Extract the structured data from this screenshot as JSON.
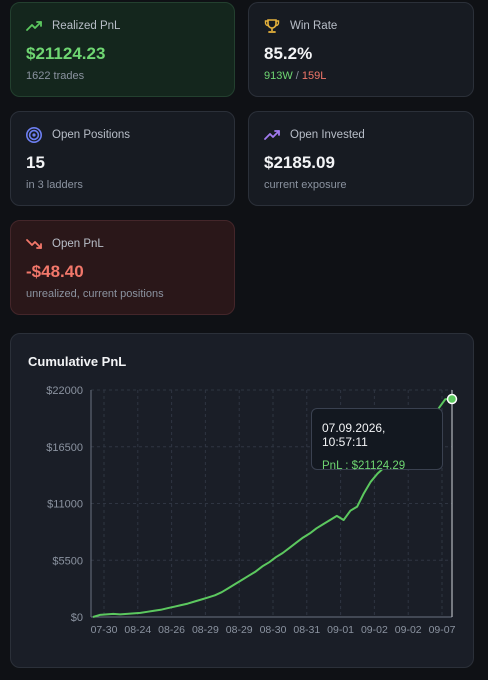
{
  "cards": {
    "realized": {
      "title": "Realized PnL",
      "value": "$21124.23",
      "sub": "1622 trades",
      "icon": "trending-up-icon"
    },
    "winrate": {
      "title": "Win Rate",
      "value": "85.2%",
      "wins": "913W",
      "sep": " / ",
      "losses": "159L",
      "icon": "trophy-icon"
    },
    "positions": {
      "title": "Open Positions",
      "value": "15",
      "sub": "in 3 ladders",
      "icon": "target-icon"
    },
    "invested": {
      "title": "Open Invested",
      "value": "$2185.09",
      "sub": "current exposure",
      "icon": "trending-up-purple-icon"
    },
    "openpnl": {
      "title": "Open PnL",
      "value": "-$48.40",
      "sub": "unrealized, current positions",
      "icon": "trending-down-icon"
    }
  },
  "colors": {
    "positive": "#6fd672",
    "negative": "#f1776a",
    "line": "#5cc85f"
  },
  "tooltip": {
    "date": "07.09.2026, 10:57:11",
    "label": "PnL",
    "sep": " : ",
    "value": "$21124.29"
  },
  "chart_data": {
    "type": "line",
    "title": "Cumulative PnL",
    "ylim": [
      0,
      22000
    ],
    "y_ticks": [
      "$0",
      "$5500",
      "$11000",
      "$16500",
      "$22000"
    ],
    "y_tick_values": [
      0,
      5500,
      11000,
      16500,
      22000
    ],
    "x_ticks": [
      "07-30",
      "08-24",
      "08-26",
      "08-29",
      "08-29",
      "08-30",
      "08-31",
      "09-01",
      "09-02",
      "09-02",
      "09-07"
    ],
    "grid": true,
    "series": [
      {
        "values": [
          0,
          200,
          250,
          300,
          250,
          300,
          350,
          400,
          500,
          600,
          700,
          850,
          1000,
          1150,
          1300,
          1500,
          1700,
          1900,
          2100,
          2400,
          2800,
          3200,
          3600,
          4000,
          4400,
          4900,
          5300,
          5800,
          6200,
          6700,
          7200,
          7700,
          8100,
          8600,
          9000,
          9400,
          9800,
          9400,
          10300,
          10700,
          12000,
          13100,
          13900,
          14500,
          15000,
          15500,
          16200,
          17000,
          17800,
          18600,
          19400,
          20200,
          21100,
          21124.29
        ]
      }
    ]
  }
}
